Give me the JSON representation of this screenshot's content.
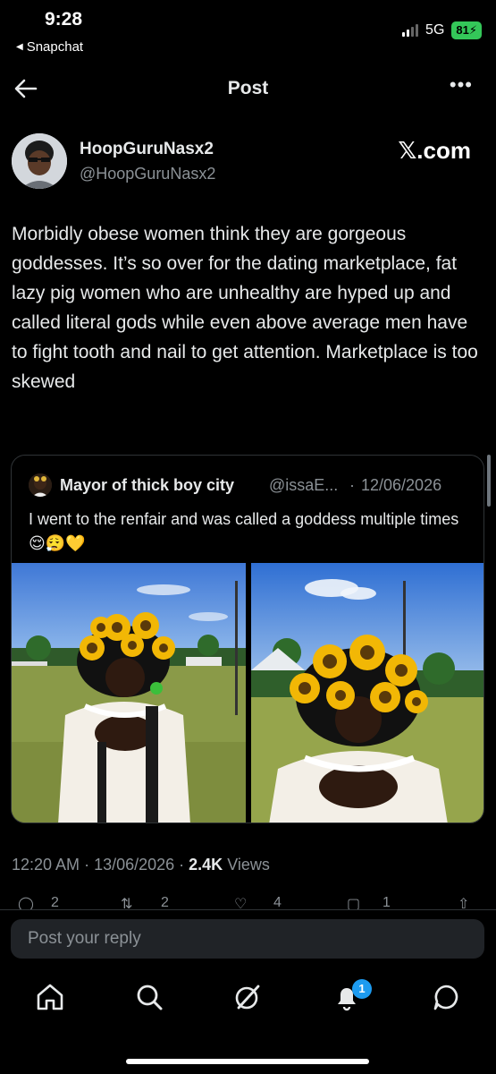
{
  "status_bar": {
    "time": "9:28",
    "back_app": "Snapchat",
    "network": "5G",
    "battery": "81"
  },
  "header": {
    "title": "Post",
    "more": "•••"
  },
  "author": {
    "name": "HoopGuruNasx2",
    "handle": "@HoopGuruNasx2",
    "watermark": "𝕏.com"
  },
  "tweet": {
    "text": "Morbidly obese women think they are gorgeous goddesses. It’s so over for the dating marketplace, fat lazy pig women who are unhealthy are hyped up and called literal gods while even above average men have to fight tooth and nail to get attention. Marketplace is too skewed"
  },
  "quoted": {
    "name": "Mayor of thick boy city",
    "handle": "@issaE...",
    "separator": "·",
    "date": "12/06/2026",
    "text": "I went to the renfair and was called a goddess multiple times 😌😮‍💨💛"
  },
  "meta": {
    "time": "12:20 AM",
    "dot1": "·",
    "date": "13/06/2026",
    "dot2": "·",
    "views_count": "2.4K",
    "views_label": "Views"
  },
  "actions": {
    "replies": "2",
    "reposts": "2",
    "likes": "4",
    "bookmarks": "1"
  },
  "reply": {
    "placeholder": "Post your reply"
  },
  "tabbar": {
    "notifications_badge": "1"
  },
  "colors": {
    "background": "#000000",
    "text": "#e7e9ea",
    "muted": "#8b9196",
    "accent": "#1d9bf0",
    "battery": "#34c759"
  },
  "icons": [
    "back-arrow-icon",
    "more-icon",
    "home-icon",
    "search-icon",
    "grok-icon",
    "bell-icon",
    "messages-icon"
  ]
}
